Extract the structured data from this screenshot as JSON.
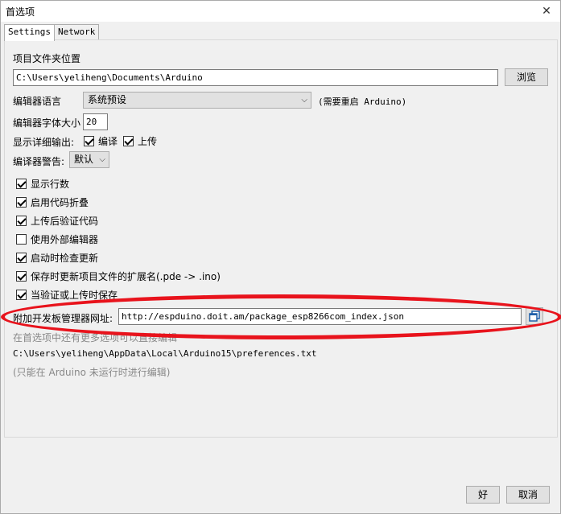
{
  "window": {
    "title": "首选项",
    "close_glyph": "✕"
  },
  "tabs": [
    {
      "label": "Settings"
    },
    {
      "label": "Network"
    }
  ],
  "sketchbook": {
    "label": "项目文件夹位置",
    "path": "C:\\Users\\yeliheng\\Documents\\Arduino",
    "browse_label": "浏览"
  },
  "language": {
    "label": "编辑器语言",
    "selected": "系统预设",
    "note": "(需要重启 Arduino)"
  },
  "font_size": {
    "label": "编辑器字体大小",
    "value": "20"
  },
  "verbose": {
    "label": "显示详细输出:",
    "compile_label": "编译",
    "upload_label": "上传",
    "compile_checked": true,
    "upload_checked": true
  },
  "warnings": {
    "label": "编译器警告:",
    "selected": "默认"
  },
  "options": [
    {
      "label": "显示行数",
      "checked": true
    },
    {
      "label": "启用代码折叠",
      "checked": true
    },
    {
      "label": "上传后验证代码",
      "checked": true
    },
    {
      "label": "使用外部编辑器",
      "checked": false
    },
    {
      "label": "启动时检查更新",
      "checked": true
    },
    {
      "label": "保存时更新项目文件的扩展名(.pde -> .ino)",
      "checked": true
    },
    {
      "label": "当验证或上传时保存",
      "checked": true
    }
  ],
  "boards_url": {
    "label": "附加开发板管理器网址:",
    "value": "http://espduino.doit.am/package_esp8266com_index.json"
  },
  "more_prefs_hint": "在首选项中还有更多选项可以直接编辑",
  "prefs_path": "C:\\Users\\yeliheng\\AppData\\Local\\Arduino15\\preferences.txt",
  "edit_note": "(只能在 Arduino 未运行时进行编辑)",
  "footer": {
    "ok_label": "好",
    "cancel_label": "取消"
  },
  "annotation": {
    "color": "#e8131c"
  }
}
